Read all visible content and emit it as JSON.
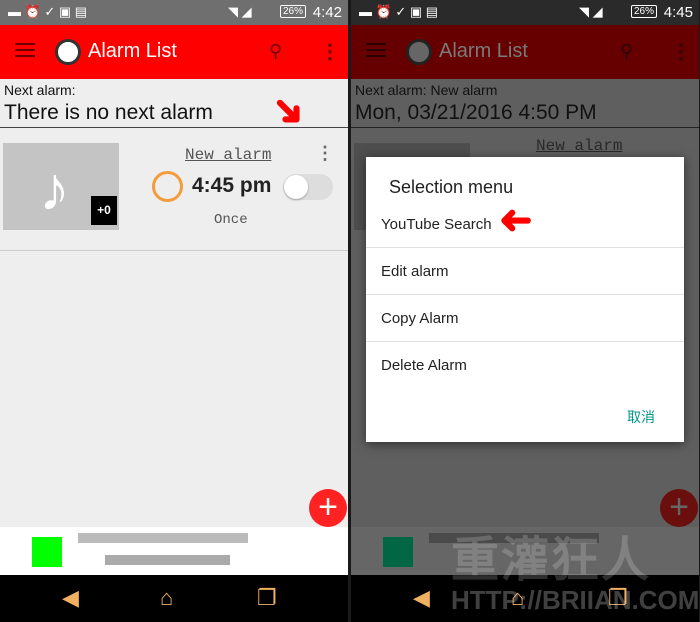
{
  "left": {
    "status_time": "4:42",
    "battery": "26%",
    "title": "Alarm List",
    "next_label": "Next alarm:",
    "next_value": "There is no next alarm",
    "alarm": {
      "name": "New alarm",
      "time": "4:45 pm",
      "repeat": "Once",
      "badge": "+0",
      "enabled": false
    }
  },
  "right": {
    "status_time": "4:45",
    "battery": "26%",
    "title": "Alarm List",
    "next_label": "Next alarm: New alarm",
    "next_value": "Mon, 03/21/2016 4:50 PM",
    "alarm": {
      "name": "New alarm"
    },
    "dialog": {
      "title": "Selection menu",
      "items": [
        "YouTube Search",
        "Edit alarm",
        "Copy Alarm",
        "Delete Alarm"
      ],
      "cancel": "取消"
    }
  },
  "watermark": {
    "text": "重灌狂人",
    "url": "HTTP://BRIIAN.COM"
  },
  "colors": {
    "appbar": "#ff0000",
    "fab": "#ff2222",
    "accent": "#009688",
    "alarm_icon": "#f39c3c"
  }
}
